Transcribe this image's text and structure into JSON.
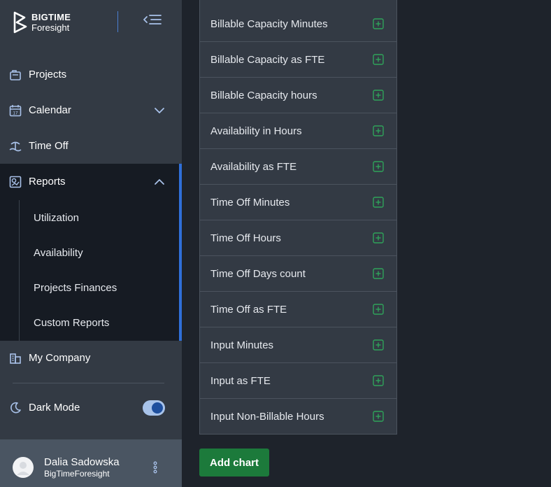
{
  "brand": {
    "name": "BIGTIME",
    "product": "Foresight"
  },
  "nav": {
    "projects": "Projects",
    "calendar": "Calendar",
    "time_off": "Time Off",
    "reports": "Reports",
    "reports_sub": [
      "Utilization",
      "Availability",
      "Projects Finances",
      "Custom Reports"
    ],
    "my_company": "My Company",
    "dark_mode": "Dark Mode",
    "dark_mode_on": true
  },
  "user": {
    "name": "Dalia Sadowska",
    "org": "BigTimeForesight"
  },
  "metrics": [
    "Billable Capacity Minutes",
    "Billable Capacity as FTE",
    "Billable Capacity hours",
    "Availability in Hours",
    "Availability as FTE",
    "Time Off Minutes",
    "Time Off Hours",
    "Time Off Days count",
    "Time Off as FTE",
    "Input Minutes",
    "Input as FTE",
    "Input Non-Billable Hours"
  ],
  "actions": {
    "add_chart": "Add chart"
  },
  "colors": {
    "accent": "#2f6fd8",
    "add_icon": "#2fa35a",
    "primary_button": "#1c7a3b"
  }
}
